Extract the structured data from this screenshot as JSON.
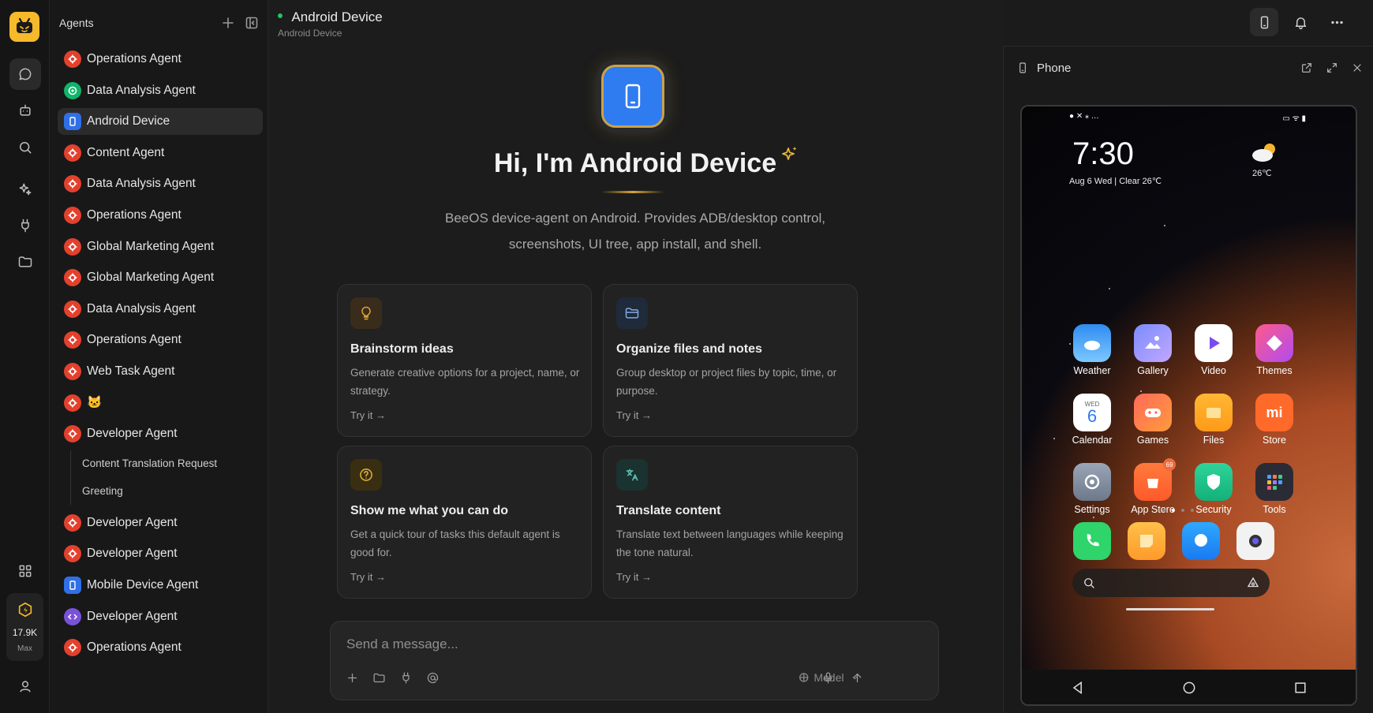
{
  "sidebar": {
    "title": "Agents",
    "items": [
      {
        "label": "Operations Agent",
        "avatar": "red"
      },
      {
        "label": "Data Analysis Agent",
        "avatar": "green"
      },
      {
        "label": "Android Device",
        "avatar": "blue",
        "active": true
      },
      {
        "label": "Content Agent",
        "avatar": "red"
      },
      {
        "label": "Data Analysis Agent",
        "avatar": "red"
      },
      {
        "label": "Operations Agent",
        "avatar": "red"
      },
      {
        "label": "Global Marketing Agent",
        "avatar": "red"
      },
      {
        "label": "Global Marketing Agent",
        "avatar": "red"
      },
      {
        "label": "Data Analysis Agent",
        "avatar": "red"
      },
      {
        "label": "Operations Agent",
        "avatar": "red"
      },
      {
        "label": "Web Task Agent",
        "avatar": "red"
      },
      {
        "label": "🐱",
        "avatar": "red"
      },
      {
        "label": "Developer Agent",
        "avatar": "red"
      }
    ],
    "sub_items": [
      "Content Translation Request",
      "Greeting"
    ],
    "items_after": [
      {
        "label": "Developer Agent",
        "avatar": "red"
      },
      {
        "label": "Developer Agent",
        "avatar": "red"
      },
      {
        "label": "Mobile Device Agent",
        "avatar": "blue"
      },
      {
        "label": "Developer Agent",
        "avatar": "purple"
      },
      {
        "label": "Operations Agent",
        "avatar": "red"
      }
    ]
  },
  "rail": {
    "credits_amount": "17.9K",
    "credits_plan": "Max"
  },
  "header": {
    "title": "Android Device",
    "subtitle": "Android Device"
  },
  "hero": {
    "title": "Hi, I'm Android Device",
    "description": "BeeOS device-agent on Android. Provides ADB/desktop control, screenshots, UI tree, app install, and shell."
  },
  "cards": [
    {
      "title": "Brainstorm ideas",
      "desc": "Generate creative options for a project, name, or strategy.",
      "try": "Try it →",
      "icon": "lightbulb-icon"
    },
    {
      "title": "Organize files and notes",
      "desc": "Group desktop or project files by topic, time, or purpose.",
      "try": "Try it →",
      "icon": "folder-icon"
    },
    {
      "title": "Show me what you can do",
      "desc": "Get a quick tour of tasks this default agent is good for.",
      "try": "Try it →",
      "icon": "help-circle-icon"
    },
    {
      "title": "Translate content",
      "desc": "Translate text between languages while keeping the tone natural.",
      "try": "Try it →",
      "icon": "translate-icon"
    }
  ],
  "composer": {
    "placeholder": "Send a message...",
    "model_label": "Model"
  },
  "phone_panel": {
    "title": "Phone",
    "clock": "7:30",
    "date": "Aug 6 Wed | Clear 26℃",
    "temp": "26℃",
    "apps": [
      {
        "label": "Weather",
        "icon": "weather-app-icon"
      },
      {
        "label": "Gallery",
        "icon": "gallery-app-icon"
      },
      {
        "label": "Video",
        "icon": "video-app-icon"
      },
      {
        "label": "Themes",
        "icon": "themes-app-icon"
      },
      {
        "label": "Calendar",
        "icon": "calendar-app-icon",
        "cal_day": "WED",
        "cal_num": "6"
      },
      {
        "label": "Games",
        "icon": "games-app-icon"
      },
      {
        "label": "Files",
        "icon": "files-app-icon"
      },
      {
        "label": "Store",
        "icon": "store-app-icon"
      },
      {
        "label": "Settings",
        "icon": "settings-app-icon"
      },
      {
        "label": "App Store",
        "icon": "app-store-app-icon",
        "badge": "69"
      },
      {
        "label": "Security",
        "icon": "security-app-icon"
      },
      {
        "label": "Tools",
        "icon": "tools-app-icon"
      }
    ],
    "store_text": "mi"
  }
}
